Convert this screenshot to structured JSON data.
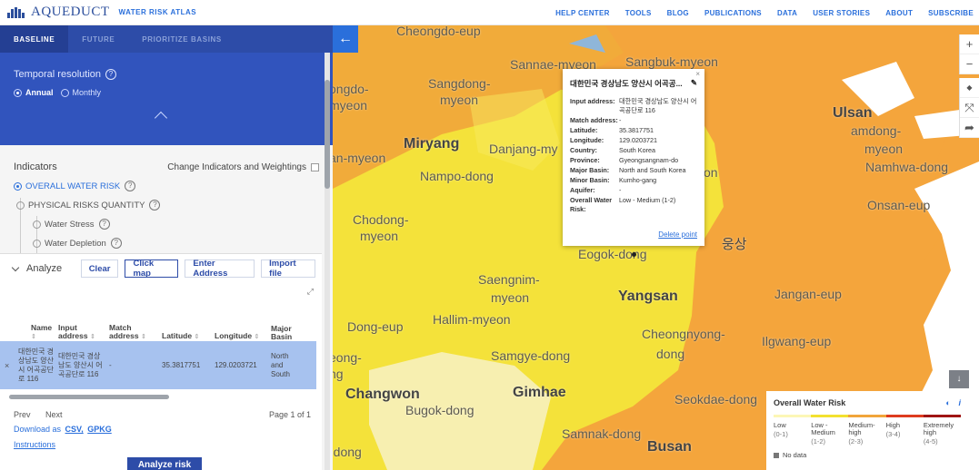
{
  "nav": {
    "logo_text": "AQUEDUCT",
    "logo_sub": "WATER RISK ATLAS",
    "links": [
      "HELP CENTER",
      "TOOLS",
      "BLOG",
      "PUBLICATIONS",
      "DATA",
      "USER STORIES",
      "ABOUT",
      "SUBSCRIBE"
    ]
  },
  "panel": {
    "tabs": [
      "BASELINE",
      "FUTURE",
      "PRIORITIZE BASINS"
    ],
    "temporal_title": "Temporal resolution",
    "annual": "Annual",
    "monthly": "Monthly",
    "indicators_title": "Indicators",
    "change_label": "Change Indicators and Weightings",
    "ind_items": [
      "OVERALL WATER RISK",
      "PHYSICAL RISKS QUANTITY",
      "Water Stress",
      "Water Depletion"
    ],
    "help_glyph": "?"
  },
  "analyze": {
    "title": "Analyze",
    "buttons": [
      "Clear",
      "Click map",
      "Enter Address",
      "Import file"
    ],
    "columns": [
      "Name",
      "Input address",
      "Match address",
      "Latitude",
      "Longitude",
      "Major Basin"
    ],
    "row": {
      "name": "대한민국 경상남도 양산시 어곡공단로 116",
      "input": "대한민국 경상남도 양산시 어곡공단로 116",
      "match": "-",
      "lat": "35.3817751",
      "lon": "129.0203721",
      "basin": "North and South Korea"
    },
    "prev": "Prev",
    "next": "Next",
    "page": "Page 1 of 1",
    "download_prefix": "Download as",
    "csv": "CSV,",
    "gpkg": "GPKG",
    "instructions": "Instructions",
    "analyze_btn": "Analyze risk"
  },
  "map": {
    "places": [
      {
        "t": "Cheongdo-eup",
        "cls": "mid"
      },
      {
        "t": "Sannae-myeon",
        "cls": "mid"
      },
      {
        "t": "Sangbuk-myeon",
        "cls": "mid"
      },
      {
        "t": "ongdo-",
        "cls": "mid"
      },
      {
        "t": "myeon",
        "cls": "mid"
      },
      {
        "t": "Sangdong-",
        "cls": "mid"
      },
      {
        "t": "myeon",
        "cls": "mid"
      },
      {
        "t": "Ulsan",
        "cls": "big"
      },
      {
        "t": "amdong-",
        "cls": "mid"
      },
      {
        "t": "myeon",
        "cls": "mid"
      },
      {
        "t": "Miryang",
        "cls": "big"
      },
      {
        "t": "Danjang-my",
        "cls": "mid"
      },
      {
        "t": "an-myeon",
        "cls": "mid"
      },
      {
        "t": "Namhwa-dong",
        "cls": "mid"
      },
      {
        "t": "Nampo-dong",
        "cls": "mid"
      },
      {
        "t": "on",
        "cls": "mid"
      },
      {
        "t": "Onsan-eup",
        "cls": "mid"
      },
      {
        "t": "Chodong-",
        "cls": "mid"
      },
      {
        "t": "myeon",
        "cls": "mid"
      },
      {
        "t": "웅상",
        "cls": "kr"
      },
      {
        "t": "Eogok-dong",
        "cls": "mid"
      },
      {
        "t": "Saengnim-",
        "cls": "mid"
      },
      {
        "t": "myeon",
        "cls": "mid"
      },
      {
        "t": "Yangsan",
        "cls": "big"
      },
      {
        "t": "Jangan-eup",
        "cls": "mid"
      },
      {
        "t": "Dong-eup",
        "cls": "mid"
      },
      {
        "t": "Hallim-myeon",
        "cls": "mid"
      },
      {
        "t": "Cheongnyong-",
        "cls": "mid"
      },
      {
        "t": "dong",
        "cls": "mid"
      },
      {
        "t": "Ilgwang-eup",
        "cls": "mid"
      },
      {
        "t": "eong-",
        "cls": "mid"
      },
      {
        "t": "ng",
        "cls": "mid"
      },
      {
        "t": "Samgye-dong",
        "cls": "mid"
      },
      {
        "t": "Changwon",
        "cls": "big"
      },
      {
        "t": "Gimhae",
        "cls": "big"
      },
      {
        "t": "Seokdae-dong",
        "cls": "mid"
      },
      {
        "t": "Bugok-dong",
        "cls": "mid"
      },
      {
        "t": "Samnak-dong",
        "cls": "mid"
      },
      {
        "t": "-dong",
        "cls": "mid"
      },
      {
        "t": "Busan",
        "cls": "big"
      }
    ],
    "controls": [
      "+",
      "−",
      "◆",
      "⤧",
      "➦"
    ],
    "back_icon": "←",
    "down_icon": "↓"
  },
  "popup": {
    "title": "대한민국 경상남도 양산시 어곡공...",
    "edit_icon": "✎",
    "close": "×",
    "rows": [
      {
        "k": "Input address:",
        "v": "대한민국 경상남도 양산시 어곡공단로 116"
      },
      {
        "k": "Match address:",
        "v": "-"
      },
      {
        "k": "Latitude:",
        "v": "35.3817751"
      },
      {
        "k": "Longitude:",
        "v": "129.0203721"
      },
      {
        "k": "Country:",
        "v": "South Korea"
      },
      {
        "k": "Province:",
        "v": "Gyeongsangnam-do"
      },
      {
        "k": "Major Basin:",
        "v": "North and South Korea"
      },
      {
        "k": "Minor Basin:",
        "v": "Kumho-gang"
      },
      {
        "k": "Aquifer:",
        "v": "-"
      },
      {
        "k": "Overall Water Risk:",
        "v": "Low - Medium (1-2)"
      }
    ],
    "delete": "Delete point"
  },
  "legend": {
    "title": "Overall Water Risk",
    "info_icon": "i",
    "toggle_icon": "◐",
    "levels": [
      {
        "label": "Low",
        "range": "(0-1)",
        "color": "#fcf7b6"
      },
      {
        "label": "Low - Medium",
        "range": "(1-2)",
        "color": "#f3e12f"
      },
      {
        "label": "Medium-high",
        "range": "(2-3)",
        "color": "#f1a53a"
      },
      {
        "label": "High",
        "range": "(3-4)",
        "color": "#de3c1f"
      },
      {
        "label": "Extremely high",
        "range": "(4-5)",
        "color": "#9f1514"
      }
    ],
    "no_data": "No data"
  },
  "colors": {
    "brand": "#2d4ca8",
    "link": "#2a6fdb",
    "low": "#fbf4b3",
    "low_medium": "#f4e23a",
    "medium_high": "#f4a53c"
  }
}
